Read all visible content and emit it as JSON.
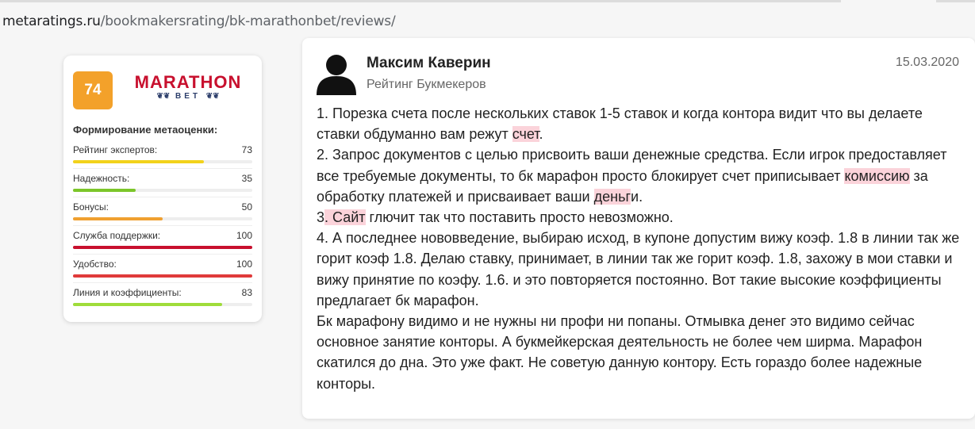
{
  "browser": {
    "url_domain": "metaratings.ru",
    "url_path": "/bookmakersrating/bk-marathonbet/reviews/"
  },
  "rating_card": {
    "score": "74",
    "brand_line1": "MARATHON",
    "brand_line2": "BET",
    "title": "Формирование метаоценки:",
    "metrics": [
      {
        "label": "Рейтинг экспертов:",
        "value": "73",
        "fill": 0.73,
        "color": "#f2d21b"
      },
      {
        "label": "Надежность:",
        "value": "35",
        "fill": 0.35,
        "color": "#7cc62a"
      },
      {
        "label": "Бонусы:",
        "value": "50",
        "fill": 0.5,
        "color": "#f0a030"
      },
      {
        "label": "Служба поддержки:",
        "value": "100",
        "fill": 1.0,
        "color": "#c8102e"
      },
      {
        "label": "Удобство:",
        "value": "100",
        "fill": 1.0,
        "color": "#e03a3a"
      },
      {
        "label": "Линия и коэффициенты:",
        "value": "83",
        "fill": 0.83,
        "color": "#9fdc3a"
      }
    ]
  },
  "review": {
    "author": "Максим Каверин",
    "source": "Рейтинг Букмекеров",
    "date": "15.03.2020",
    "p1": {
      "a": "1. Порезка счета после нескольких ставок 1-5 ставок и когда контора видит что вы делаете ставки обдуманно вам режут ",
      "h": "счет",
      "b": "."
    },
    "p2": {
      "a": "2. Запрос документов с целью присвоить ваши денежные средства. Если игрок предоставляет все требуемые документы, то бк марафон просто блокирует счет приписывает ",
      "h1": " комиссию",
      "b": " за обработку платежей и присваивает ваши ",
      "h2": "деньг",
      "c": "и."
    },
    "p3": {
      "a": "3",
      "h": ". Сайт",
      "b": " глючит так что поставить просто невозможно."
    },
    "p4": "4. А последнее нововведение, выбираю исход, в купоне допустим вижу коэф. 1.8 в линии так же горит коэф 1.8. Делаю ставку, принимает, в линии так же горит коэф. 1.8, захожу в мои ставки и вижу принятие по коэфу. 1.6. и это повторяется постоянно. Вот такие высокие коэффициенты предлагает бк марафон.",
    "p5": "Бк марафону видимо и не нужны ни профи ни попаны. Отмывка денег это видимо сейчас основное занятие конторы. А букмейкерская деятельность не более чем ширма. Марафон скатился до дна. Это уже факт. Не советую данную контору. Есть гораздо более надежные конторы."
  }
}
